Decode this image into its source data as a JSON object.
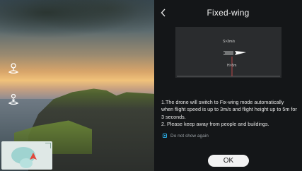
{
  "camera": {
    "takeoff_icon": "takeoff-icon",
    "landing_icon": "landing-icon",
    "minimap_icon": "map-pin-icon"
  },
  "panel": {
    "back_icon": "chevron-left-icon",
    "title": "Fixed-wing",
    "diagram": {
      "speed_label": "S>3m/s",
      "height_label": "H>5m",
      "aircraft_icon": "plane-icon"
    },
    "description": [
      "1.The drone will switch to Fix-wing mode automatically when flight speed is up to 3m/s and flight height up to 5m for 3 seconds.",
      "2. Please keep away from people and buildings."
    ],
    "checkbox_label": "Do not show again",
    "ok_label": "OK"
  },
  "colors": {
    "accent": "#29a8e0",
    "height_line": "#e05050",
    "panel_bg": "#16181a"
  }
}
